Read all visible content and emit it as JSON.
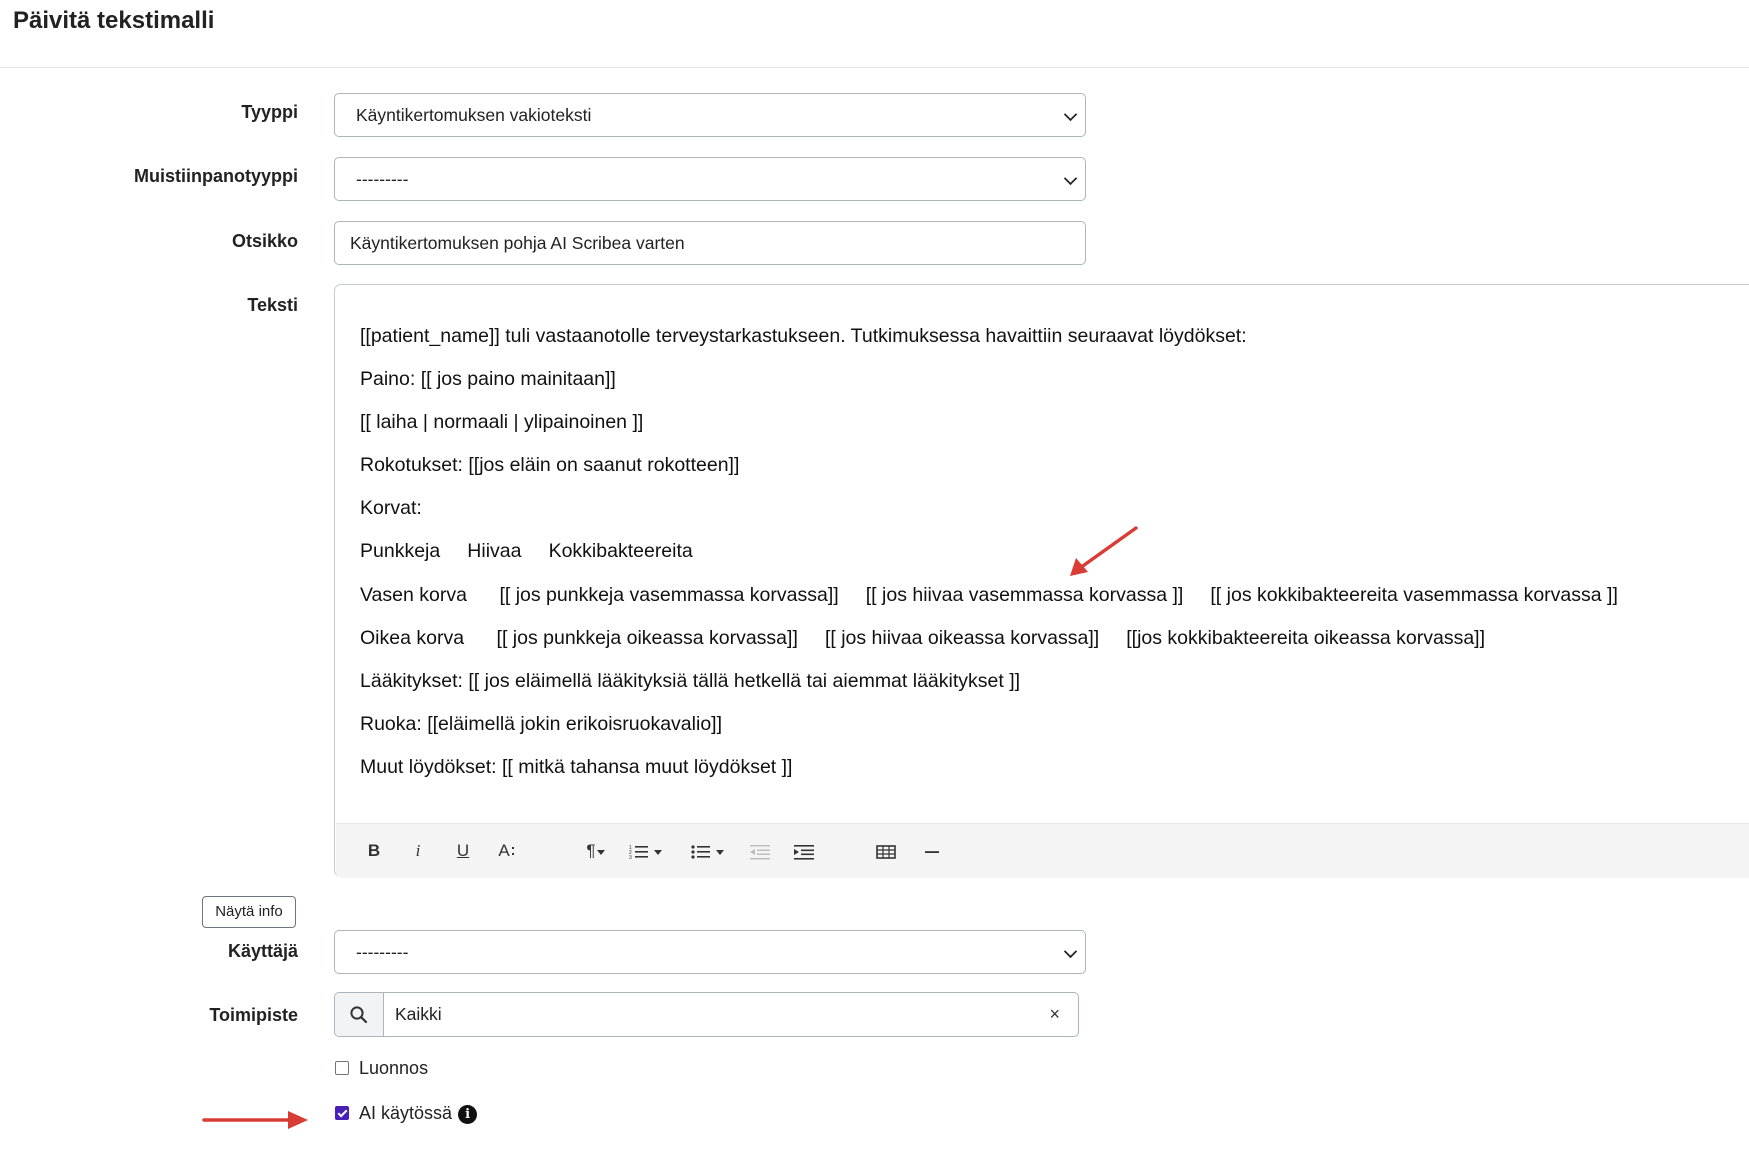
{
  "page_title": "Päivitä tekstimalli",
  "form": {
    "tyyppi": {
      "label": "Tyyppi",
      "value": "Käyntikertomuksen vakioteksti"
    },
    "muistiinpanotyyppi": {
      "label": "Muistiinpanotyyppi",
      "value": "---------"
    },
    "otsikko": {
      "label": "Otsikko",
      "value": "Käyntikertomuksen pohja AI Scribea varten"
    },
    "teksti": {
      "label": "Teksti",
      "lines": [
        "[[patient_name]] tuli vastaanotolle terveystarkastukseen. Tutkimuksessa havaittiin seuraavat löydökset:",
        "Paino: [[ jos paino mainitaan]]",
        "[[ laiha | normaali | ylipainoinen ]]",
        "Rokotukset: [[jos eläin on saanut rokotteen]]",
        "Korvat:",
        "Punkkeja     Hiivaa     Kokkibakteereita",
        "Vasen korva      [[ jos punkkeja vasemmassa korvassa]]     [[ jos hiivaa vasemmassa korvassa ]]     [[ jos kokkibakteereita vasemmassa korvassa ]]",
        "Oikea korva      [[ jos punkkeja oikeassa korvassa]]     [[ jos hiivaa oikeassa korvassa]]     [[jos kokkibakteereita oikeassa korvassa]]",
        "Lääkitykset: [[ jos eläimellä lääkityksiä tällä hetkellä tai aiemmat lääkitykset ]]",
        "Ruoka: [[eläimellä jokin erikoisruokavalio]]",
        "Muut löydökset: [[ mitkä tahansa muut löydökset ]]"
      ],
      "toolbar": {
        "bold": "B",
        "italic": "i",
        "underline": "U",
        "font_size": "A",
        "paragraph": "¶"
      }
    },
    "show_info_button": "Näytä info",
    "kayttaja": {
      "label": "Käyttäjä",
      "value": "---------"
    },
    "toimipiste": {
      "label": "Toimipiste",
      "value": "Kaikki",
      "clear": "×"
    },
    "luonnos": {
      "label": "Luonnos",
      "checked": false
    },
    "ai_kaytossa": {
      "label": "AI käytössä",
      "checked": true,
      "info_symbol": "i"
    }
  },
  "colors": {
    "accent_checkbox": "#4a1fb8",
    "annotation_arrow": "#d93b35",
    "spellcheck": "#e0312f"
  },
  "icons": [
    "chevron-down-icon",
    "search-icon",
    "close-icon",
    "info-icon",
    "arrow-annotation"
  ]
}
